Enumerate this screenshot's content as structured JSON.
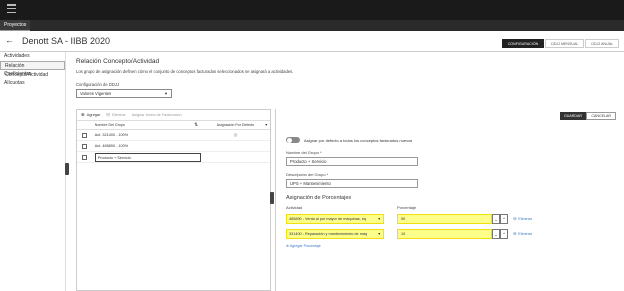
{
  "topbar": {
    "menu_icon": "hamburger-icon"
  },
  "tabbar": {
    "tab_label": "Proyectos"
  },
  "header": {
    "back_icon": "arrow-left-icon",
    "title": "Denott SA - IIBB 2020",
    "tabs": [
      {
        "label": "CONFIGURACIÓN",
        "active": true
      },
      {
        "label": "DDJJ MENSUAL",
        "active": false
      },
      {
        "label": "DDJJ ANUAL",
        "active": false
      }
    ]
  },
  "sidebar": {
    "items": [
      {
        "label": "Actividades",
        "active": false
      },
      {
        "label": "Relación Concepto/Actividad",
        "active": true
      },
      {
        "label": "Coeficientes",
        "active": false
      },
      {
        "label": "Alícuotas",
        "active": false
      }
    ]
  },
  "main": {
    "title": "Relación Concepto/Actividad",
    "description": "Los grupo de asignación definen cómo el conjunto de conceptos facturados seleccionados se asignará a actividades.",
    "config_label": "Configuración de DDJJ",
    "config_value": "Valores Vigentes"
  },
  "toolbar": {
    "agregar": "Agregar",
    "eliminar": "Eliminar",
    "asignar_forma": "Asignar forma de Facturación"
  },
  "grid": {
    "col_name": "Nombre Del Grupo",
    "col_default": "Asignación Por Defecto",
    "rows": [
      {
        "name": "Act. 321400 - 100%",
        "default_icon": "circle-icon"
      },
      {
        "name": "Act. 465890 - 100%",
        "default_icon": ""
      },
      {
        "name": "Producto + Servicio",
        "default_icon": "",
        "editing": true
      }
    ]
  },
  "right": {
    "save_label": "GUARDAR",
    "cancel_label": "CANCELAR",
    "toggle_label": "Asignar por defecto a todos los conceptos facturados nuevos",
    "group_name_label": "Nombre del Grupo",
    "group_name_value": "Producto + Servicio",
    "group_desc_label": "Descripción del Grupo",
    "group_desc_value": "UPS + Mantenimiento",
    "asig_title": "Asignación de Porcentajes",
    "col_actividad": "Actividad",
    "col_porcentaje": "Porcentaje",
    "rows": [
      {
        "actividad": "465890 - Venta al por mayor de máquinas, eq",
        "porcentaje": "90",
        "remove": "Eliminar"
      },
      {
        "actividad": "331400 - Reparación y mantenimiento de maq",
        "porcentaje": "10",
        "remove": "Eliminar"
      }
    ],
    "add_pct": "Agregar Porcentaje",
    "highlight_color": "#fdfd8a",
    "link_color": "#3a78c4"
  }
}
